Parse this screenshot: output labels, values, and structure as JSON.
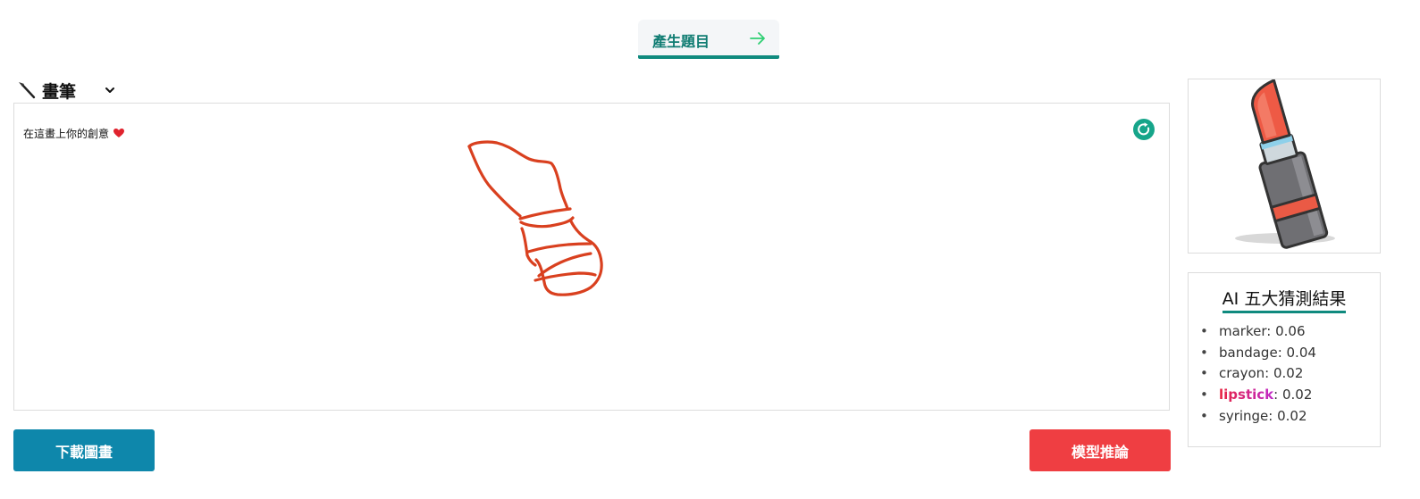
{
  "top_button": {
    "label": "產生題目",
    "icon": "arrow-right-icon"
  },
  "tool": {
    "icon": "paintbrush-icon",
    "label": "畫筆"
  },
  "canvas": {
    "hint": "在這畫上你的創意",
    "hint_icon": "heart-icon",
    "stroke_color": "#d9401f"
  },
  "buttons": {
    "download": "下載圖畫",
    "infer": "模型推論"
  },
  "target_icon": "lipstick-icon",
  "results": {
    "title": "AI 五大猜測結果",
    "items": [
      {
        "name": "marker",
        "score": "0.06",
        "highlight": false
      },
      {
        "name": "bandage",
        "score": "0.04",
        "highlight": false
      },
      {
        "name": "crayon",
        "score": "0.02",
        "highlight": false
      },
      {
        "name": "lipstick",
        "score": "0.02",
        "highlight": true
      },
      {
        "name": "syringe",
        "score": "0.02",
        "highlight": false
      }
    ]
  },
  "colors": {
    "accent_teal": "#0f8a7e",
    "download_blue": "#0e87ab",
    "infer_red": "#ef3e42"
  }
}
